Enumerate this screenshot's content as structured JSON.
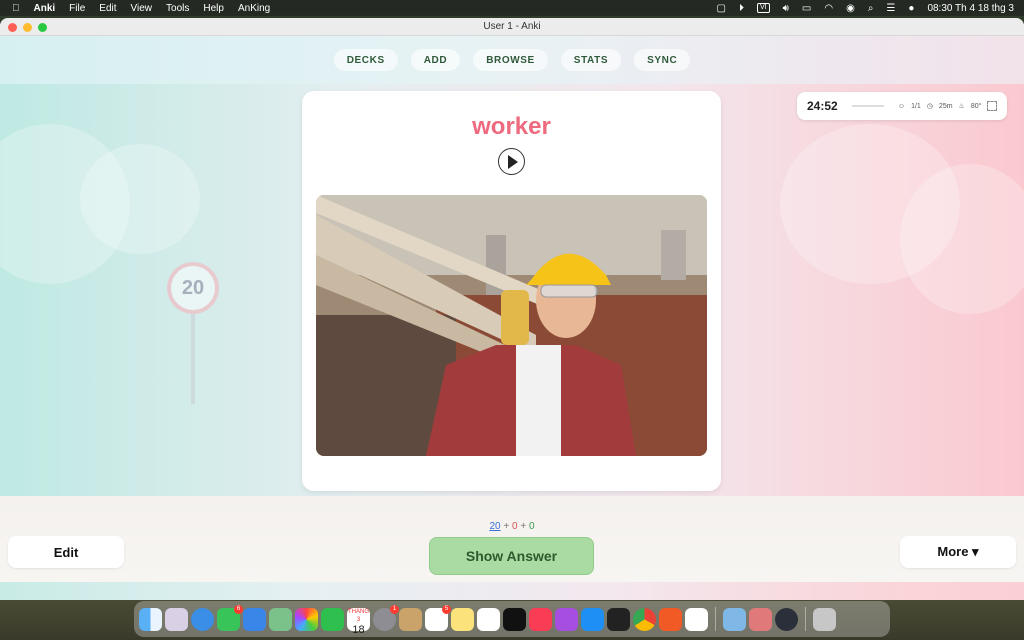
{
  "menubar": {
    "apple": "",
    "app_name": "Anki",
    "menus": [
      "File",
      "Edit",
      "View",
      "Tools",
      "Help",
      "AnKing"
    ],
    "input_source": "VI",
    "clock": "08:30 Th 4 18 thg 3"
  },
  "window": {
    "title": "User 1 - Anki"
  },
  "toolbar": {
    "decks": "DECKS",
    "add": "ADD",
    "browse": "BROWSE",
    "stats": "STATS",
    "sync": "SYNC"
  },
  "timer": {
    "time": "24:52",
    "count": "1/1",
    "minutes": "25m",
    "target": "80°"
  },
  "card": {
    "word": "worker",
    "image_description_icon": "photo-icon"
  },
  "counts": {
    "new": "20",
    "plus1": "+",
    "learn": "0",
    "plus2": "+",
    "review": "0"
  },
  "bottom": {
    "edit": "Edit",
    "show_answer": "Show Answer",
    "more": "More ▾"
  },
  "dock": {
    "calendar_month": "THÁNG 3",
    "calendar_day": "18",
    "badges": {
      "messages": "6",
      "settings": "1",
      "reminders": "5"
    }
  },
  "colors": {
    "word": "#ee6a7f",
    "show_answer_bg": "#a9dba3",
    "toolbar_text": "#2f5a3a"
  }
}
